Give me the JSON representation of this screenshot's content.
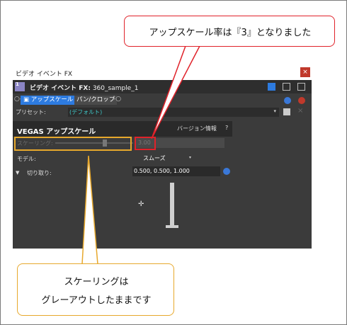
{
  "window": {
    "title": "ビデオ イベント FX",
    "close_glyph": "×",
    "header_title_bold": "ビデオ イベント FX:",
    "header_title_clip": " 360_sample_1",
    "header_thumb_num": "1"
  },
  "chain": {
    "connector_left": "○-",
    "active_label": "▣ アップスケール",
    "inactive_label": "パン/クロップ",
    "connector_right": "-○"
  },
  "preset": {
    "label": "プリセット:",
    "value": "(デフォルト)",
    "arrow": "▾",
    "delete_glyph": "×"
  },
  "plugin": {
    "title": "VEGAS アップスケール",
    "version_button": "バージョン情報",
    "help_button": "?"
  },
  "fields": {
    "scaling_label": "スケーリング:",
    "scaling_value": "3.00",
    "scaling_slider_level": 0.64,
    "model_label": "モデル:",
    "model_value": "スムーズ",
    "model_arrow": "▾",
    "crop_toggle": "▼",
    "crop_label": "切り取り:",
    "crop_value": "0.500, 0.500, 1.000"
  },
  "preview": {
    "crosshair_glyph": "✛"
  },
  "callouts": {
    "top": "アップスケール率は『3』となりました",
    "bottom_line1": "スケーリングは",
    "bottom_line2": "グレーアウトしたままです"
  },
  "colors": {
    "highlight_red": "#e0222a",
    "highlight_orange": "#e7a82c",
    "accent_blue": "#2d7be0",
    "preset_text": "#3ec7c7"
  },
  "icons": [
    "thumbnail-icon",
    "layout-single-icon",
    "layout-split-icon",
    "layout-grid-icon",
    "plugin-add-icon",
    "plugin-remove-icon",
    "save-icon",
    "delete-icon",
    "crop-options-icon",
    "crosshair-icon",
    "stand-icon"
  ]
}
